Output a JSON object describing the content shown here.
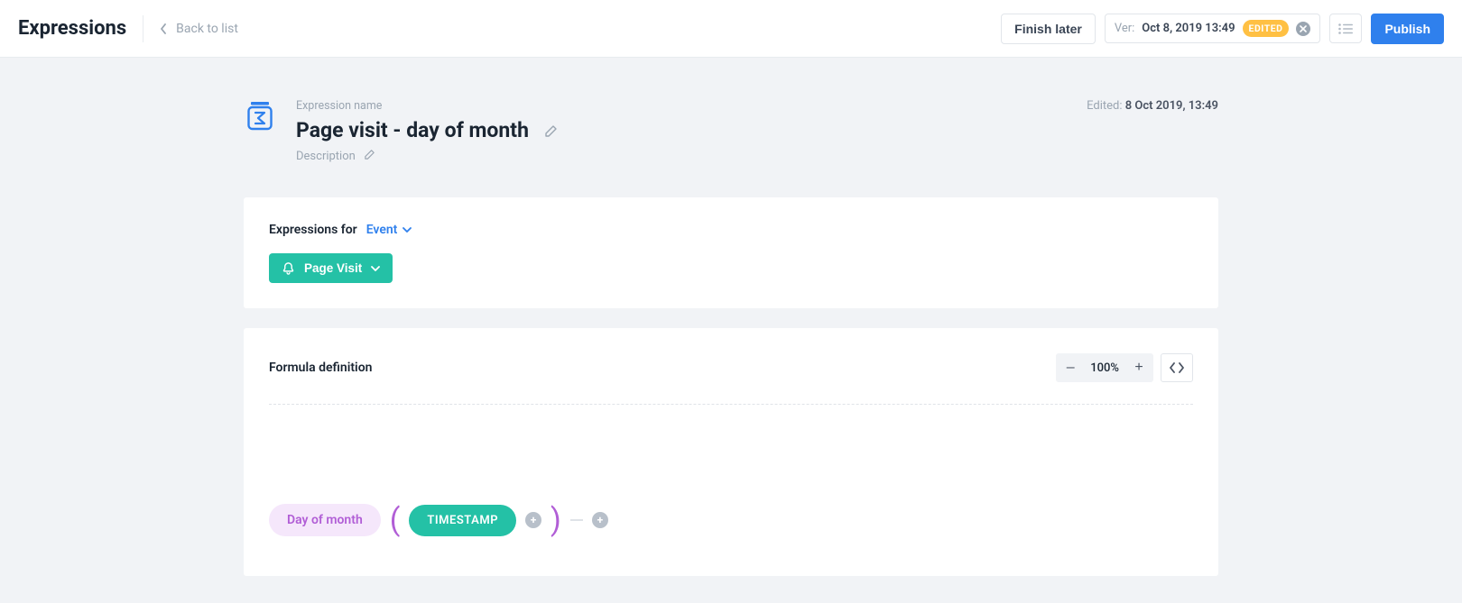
{
  "header": {
    "app_title": "Expressions",
    "back_label": "Back to list",
    "finish_later": "Finish later",
    "version_label": "Ver:",
    "version_value": "Oct 8, 2019 13:49",
    "edited_badge": "EDITED",
    "publish": "Publish"
  },
  "title": {
    "name_label": "Expression name",
    "name": "Page visit - day of month",
    "description_label": "Description",
    "edited_label": "Edited:",
    "edited_value": "8 Oct 2019, 13:49"
  },
  "expr_for": {
    "label": "Expressions for",
    "type": "Event",
    "tag": "Page Visit"
  },
  "formula": {
    "heading": "Formula definition",
    "zoom": "100%",
    "function": "Day of month",
    "argument": "TIMESTAMP"
  }
}
